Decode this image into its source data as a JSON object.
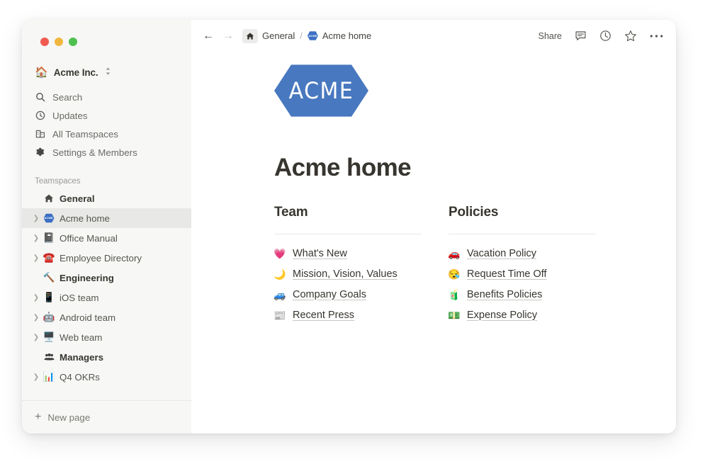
{
  "window": {
    "traffic_lights": [
      "close",
      "minimize",
      "maximize"
    ]
  },
  "sidebar": {
    "workspace": {
      "emoji": "🏠",
      "name": "Acme Inc.",
      "switcher_icon": "chevron-updown-icon"
    },
    "nav_items": [
      {
        "icon": "search-icon",
        "label": "Search"
      },
      {
        "icon": "clock-icon",
        "label": "Updates"
      },
      {
        "icon": "buildings-icon",
        "label": "All Teamspaces"
      },
      {
        "icon": "gear-icon",
        "label": "Settings & Members"
      }
    ],
    "section_label": "Teamspaces",
    "tree_items": [
      {
        "label": "General",
        "icon": "home-glyph",
        "emoji": "",
        "arrow": false,
        "bold": true,
        "selected": false
      },
      {
        "label": "Acme home",
        "icon": "acme-hex-logo",
        "emoji": "",
        "arrow": true,
        "bold": false,
        "selected": true
      },
      {
        "label": "Office Manual",
        "icon": "emoji",
        "emoji": "📓",
        "arrow": true,
        "bold": false,
        "selected": false
      },
      {
        "label": "Employee Directory",
        "icon": "emoji",
        "emoji": "☎️",
        "arrow": true,
        "bold": false,
        "selected": false
      },
      {
        "label": "Engineering",
        "icon": "emoji",
        "emoji": "🔨",
        "arrow": false,
        "bold": true,
        "selected": false
      },
      {
        "label": "iOS team",
        "icon": "emoji",
        "emoji": "📱",
        "arrow": true,
        "bold": false,
        "selected": false
      },
      {
        "label": "Android team",
        "icon": "emoji",
        "emoji": "🤖",
        "arrow": true,
        "bold": false,
        "selected": false
      },
      {
        "label": "Web team",
        "icon": "emoji",
        "emoji": "🖥️",
        "arrow": true,
        "bold": false,
        "selected": false
      },
      {
        "label": "Managers",
        "icon": "people-glyph",
        "emoji": "",
        "arrow": false,
        "bold": true,
        "selected": false
      },
      {
        "label": "Q4 OKRs",
        "icon": "emoji",
        "emoji": "📊",
        "arrow": true,
        "bold": false,
        "selected": false
      }
    ],
    "footer": {
      "icon": "plus-icon",
      "label": "New page"
    }
  },
  "topbar": {
    "back_icon": "arrow-left-icon",
    "forward_icon": "arrow-right-icon",
    "breadcrumb": {
      "home_icon": "home-icon",
      "parent": "General",
      "separator": "/",
      "current_icon": "acme-hex-logo",
      "current": "Acme home"
    },
    "share_label": "Share",
    "actions": [
      {
        "icon": "comment-icon"
      },
      {
        "icon": "history-clock-icon"
      },
      {
        "icon": "star-icon"
      },
      {
        "icon": "more-ellipsis-icon"
      }
    ]
  },
  "page": {
    "logo_text": "ACME",
    "logo_color": "#4878bf",
    "title": "Acme home",
    "columns": [
      {
        "heading": "Team",
        "links": [
          {
            "emoji": "💗",
            "label": "What's New"
          },
          {
            "emoji": "🌙",
            "label": "Mission, Vision, Values"
          },
          {
            "emoji": "🚙",
            "label": "Company Goals"
          },
          {
            "emoji": "📰",
            "label": "Recent Press"
          }
        ]
      },
      {
        "heading": "Policies",
        "links": [
          {
            "emoji": "🚗",
            "label": "Vacation Policy"
          },
          {
            "emoji": "😪",
            "label": "Request Time Off"
          },
          {
            "emoji": "🧃",
            "label": "Benefits Policies"
          },
          {
            "emoji": "💵",
            "label": "Expense Policy"
          }
        ]
      }
    ]
  }
}
